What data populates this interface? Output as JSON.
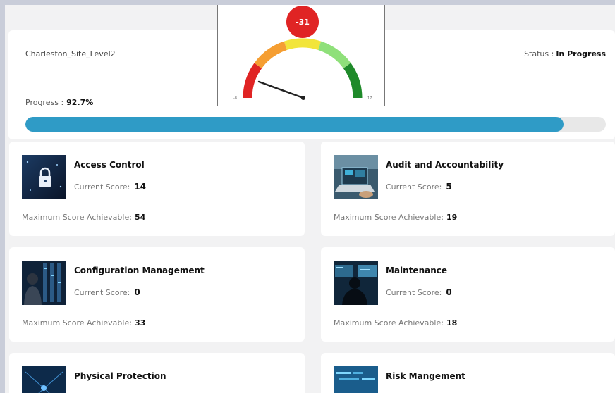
{
  "header": {
    "site_name": "Charleston_Site_Level2",
    "status_label": "Status :",
    "status_value": "In Progress",
    "progress_label": "Progress :",
    "progress_value": "92.7%",
    "progress_fraction": 0.927
  },
  "gauge": {
    "badge": "-31",
    "min_label": "-8",
    "max_label": "17",
    "colors": [
      "#e02424",
      "#f59e32",
      "#f2e53a",
      "#8fe07a",
      "#1f8a2a"
    ]
  },
  "cards": [
    {
      "title": "Access Control",
      "current_label": "Current Score:",
      "current": "14",
      "max_label": "Maximum Score Achievable:",
      "max": "54",
      "thumb": "lock-thumb"
    },
    {
      "title": "Audit and Accountability",
      "current_label": "Current Score:",
      "current": "5",
      "max_label": "Maximum Score Achievable:",
      "max": "19",
      "thumb": "laptop-thumb"
    },
    {
      "title": "Configuration Management",
      "current_label": "Current Score:",
      "current": "0",
      "max_label": "Maximum Score Achievable:",
      "max": "33",
      "thumb": "server-room-thumb"
    },
    {
      "title": "Maintenance",
      "current_label": "Current Score:",
      "current": "0",
      "max_label": "Maximum Score Achievable:",
      "max": "18",
      "thumb": "monitor-thumb"
    },
    {
      "title": "Physical Protection",
      "current_label": "",
      "current": "",
      "max_label": "",
      "max": "",
      "thumb": "network-thumb"
    },
    {
      "title": "Risk Mangement",
      "current_label": "",
      "current": "",
      "max_label": "",
      "max": "",
      "thumb": "code-thumb"
    }
  ]
}
